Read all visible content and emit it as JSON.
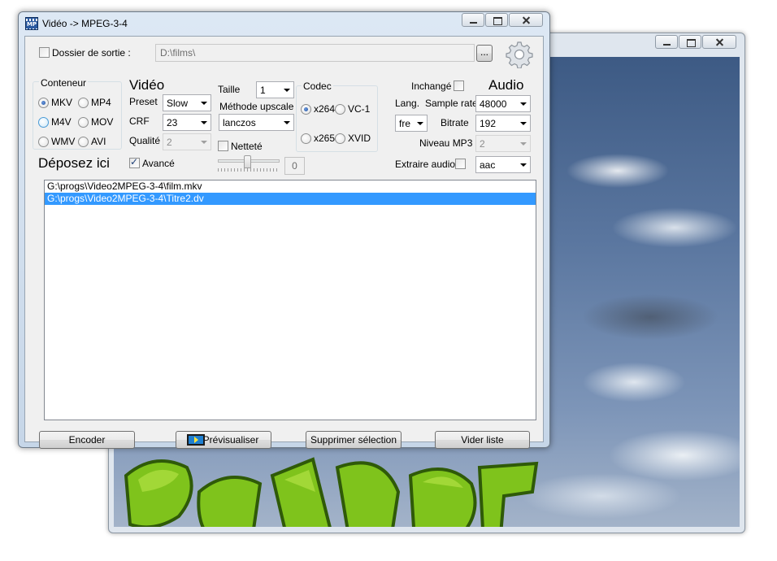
{
  "dialog": {
    "title": "Vidéo -> MPEG-3-4"
  },
  "output": {
    "folder_checkbox_label": "Dossier de sortie :",
    "folder_checked": false,
    "folder_value": "D:\\films\\",
    "browse_label": "..."
  },
  "container": {
    "group_label": "Conteneur",
    "options": [
      "MKV",
      "MP4",
      "M4V",
      "MOV",
      "WMV",
      "AVI"
    ],
    "selected": "MKV"
  },
  "video": {
    "heading": "Vidéo",
    "preset_label": "Preset",
    "preset_value": "Slow",
    "crf_label": "CRF",
    "crf_value": "23",
    "quality_label": "Qualité",
    "quality_value": "2",
    "size_label": "Taille",
    "size_value": "1",
    "upscale_label": "Méthode upscale",
    "upscale_value": "lanczos",
    "sharpness_label": "Netteté",
    "sharpness_checked": false,
    "advanced_label": "Avancé",
    "advanced_checked": true,
    "slider_value": "0"
  },
  "codec": {
    "group_label": "Codec",
    "options": [
      "x264",
      "VC-1",
      "x265",
      "XVID"
    ],
    "selected": "x264"
  },
  "audio": {
    "heading": "Audio",
    "unchanged_label": "Inchangé",
    "unchanged_checked": false,
    "lang_label": "Lang.",
    "lang_value": "fre",
    "sample_rate_label": "Sample rate",
    "sample_rate_value": "48000",
    "bitrate_label": "Bitrate",
    "bitrate_value": "192",
    "mp3_level_label": "Niveau MP3",
    "mp3_level_value": "2",
    "extract_label": "Extraire audio",
    "extract_checked": false,
    "codec_value": "aac"
  },
  "drop_label": "Déposez ici",
  "files": [
    {
      "path": "G:\\progs\\Video2MPEG-3-4\\film.mkv",
      "selected": false
    },
    {
      "path": "G:\\progs\\Video2MPEG-3-4\\Titre2.dv",
      "selected": true
    }
  ],
  "buttons": {
    "encode": "Encoder",
    "preview": "Prévisualiser",
    "delete_selection": "Supprimer sélection",
    "clear_list": "Vider liste"
  },
  "icons": {
    "app": "film-app-icon",
    "settings": "gear-icon",
    "preview": "play-icon"
  },
  "colors": {
    "selection": "#3399ff",
    "title_bar": "#c6d6e8"
  }
}
